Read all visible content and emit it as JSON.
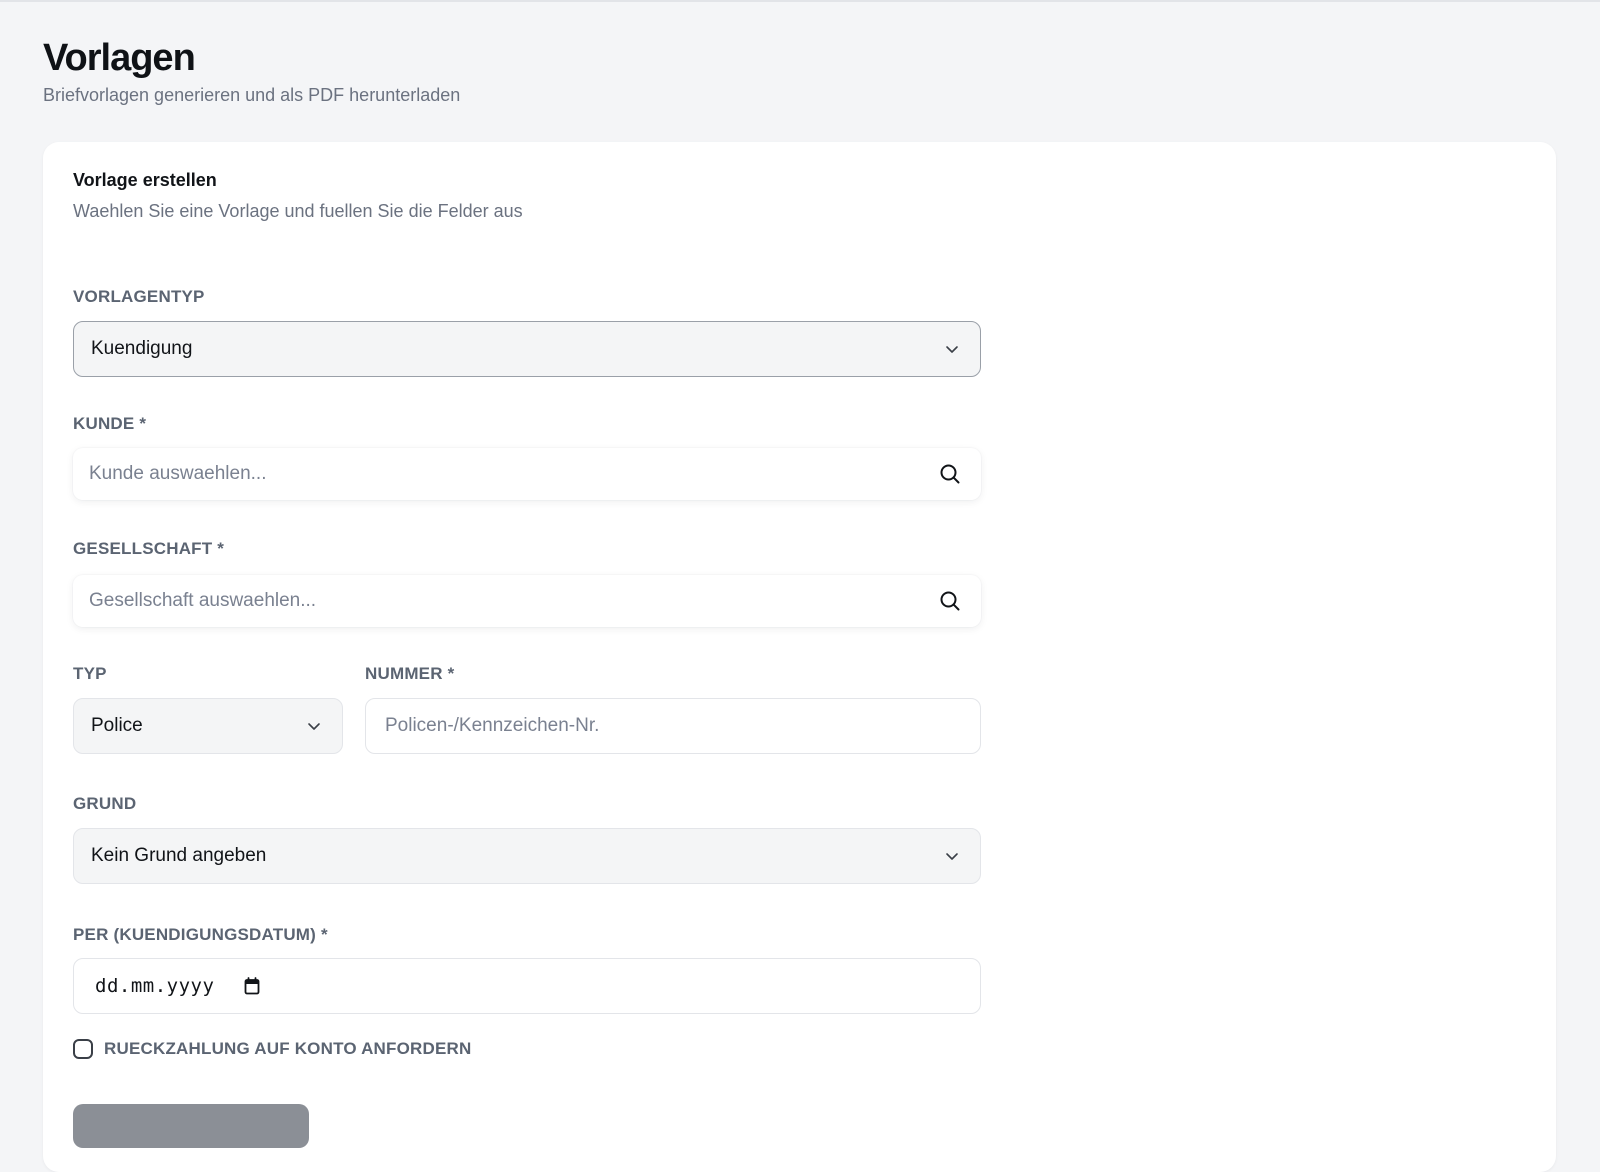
{
  "page": {
    "title": "Vorlagen",
    "subtitle": "Briefvorlagen generieren und als PDF herunterladen"
  },
  "card": {
    "title": "Vorlage erstellen",
    "description": "Waehlen Sie eine Vorlage und fuellen Sie die Felder aus"
  },
  "form": {
    "vorlagentyp": {
      "label": "VORLAGENTYP",
      "value": "Kuendigung"
    },
    "kunde": {
      "label": "KUNDE *",
      "placeholder": "Kunde auswaehlen..."
    },
    "gesellschaft": {
      "label": "GESELLSCHAFT *",
      "placeholder": "Gesellschaft auswaehlen..."
    },
    "typ": {
      "label": "TYP",
      "value": "Police"
    },
    "nummer": {
      "label": "NUMMER *",
      "placeholder": "Policen-/Kennzeichen-Nr."
    },
    "grund": {
      "label": "GRUND",
      "value": "Kein Grund angeben"
    },
    "per": {
      "label": "PER (KUENDIGUNGSDATUM) *",
      "value": "dd.mm.yyyy"
    },
    "rueckzahlung": {
      "label": "RUECKZAHLUNG AUF KONTO ANFORDERN",
      "checked": false
    }
  },
  "icons": {
    "select_chevron": "chevron-down-icon",
    "search": "search-icon",
    "date": "calendar-icon"
  },
  "colors": {
    "background": "#f4f5f7",
    "card": "#ffffff",
    "label": "#5b6472",
    "muted_text": "#6b7280",
    "submit_button": "#8b8f96"
  }
}
